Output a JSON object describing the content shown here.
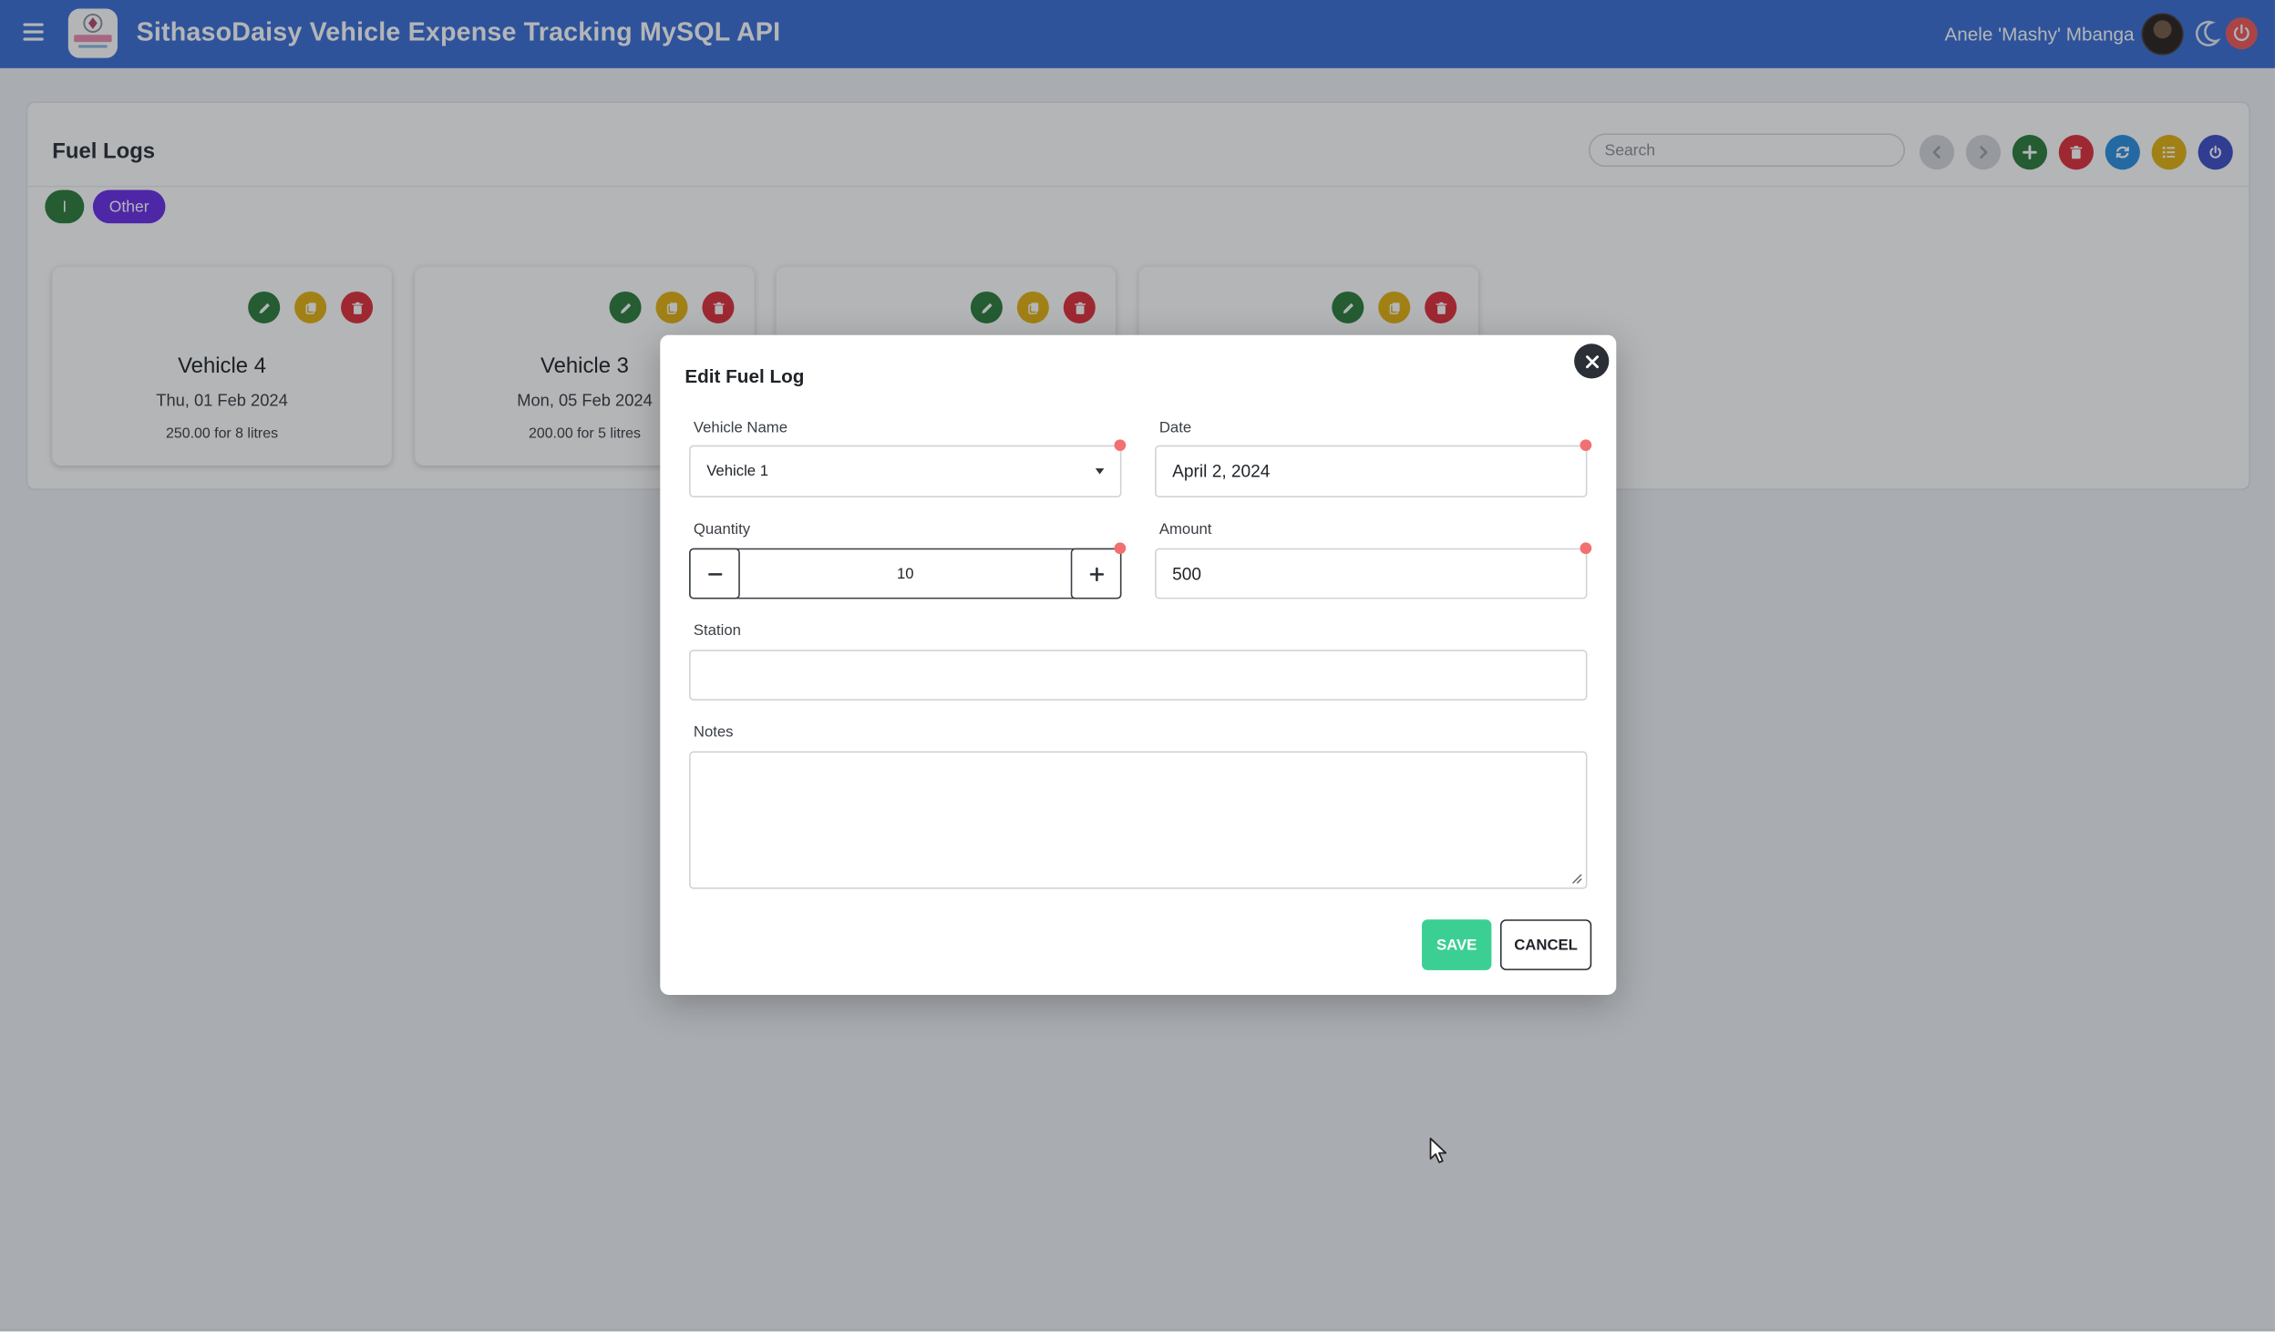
{
  "app": {
    "title": "SithasoDaisy Vehicle Expense Tracking MySQL API",
    "user_name": "Anele 'Mashy' Mbanga",
    "logo_text": "SithasoDaisy"
  },
  "page": {
    "title": "Fuel Logs",
    "search": {
      "placeholder": "Search",
      "value": ""
    }
  },
  "toolbar": {
    "buttons": [
      {
        "name": "prev-button",
        "icon": "chevron-left-icon",
        "color": "#d5d8dc"
      },
      {
        "name": "next-button",
        "icon": "chevron-right-icon",
        "color": "#d5d8dc"
      },
      {
        "name": "add-button",
        "icon": "plus-icon",
        "color": "#2f7d3c"
      },
      {
        "name": "delete-all-button",
        "icon": "trash-icon",
        "color": "#e0303a"
      },
      {
        "name": "refresh-button",
        "icon": "refresh-icon",
        "color": "#2d8fe0"
      },
      {
        "name": "list-button",
        "icon": "list-icon",
        "color": "#e5b313"
      },
      {
        "name": "power-button",
        "icon": "power-icon",
        "color": "#3e4fc7"
      }
    ]
  },
  "filters": {
    "chips": [
      {
        "label": "I",
        "color": "#2f7d3c"
      },
      {
        "label": "Other",
        "color": "#6a2ee8"
      }
    ]
  },
  "cards": [
    {
      "title": "Vehicle 4",
      "date": "Thu, 01 Feb 2024",
      "summary": "250.00 for 8 litres"
    },
    {
      "title": "Vehicle 3",
      "date": "Mon, 05 Feb 2024",
      "summary": "200.00 for 5 litres"
    },
    {
      "title": "",
      "date": "",
      "summary": ""
    },
    {
      "title": "",
      "date": "",
      "summary": ""
    }
  ],
  "modal": {
    "title": "Edit Fuel Log",
    "vehicle_name": {
      "label": "Vehicle Name",
      "value": "Vehicle 1"
    },
    "date": {
      "label": "Date",
      "value": "April 2, 2024"
    },
    "quantity": {
      "label": "Quantity",
      "value": "10"
    },
    "amount": {
      "label": "Amount",
      "value": "500"
    },
    "station": {
      "label": "Station",
      "value": ""
    },
    "notes": {
      "label": "Notes",
      "value": ""
    },
    "save_label": "SAVE",
    "cancel_label": "CANCEL"
  },
  "colors": {
    "topbar": "#3b6fd6",
    "save": "#3ccf94",
    "required_dot": "#f27070",
    "edit": "#2f7d3c",
    "copy": "#e5b313",
    "delete": "#e0303a"
  }
}
